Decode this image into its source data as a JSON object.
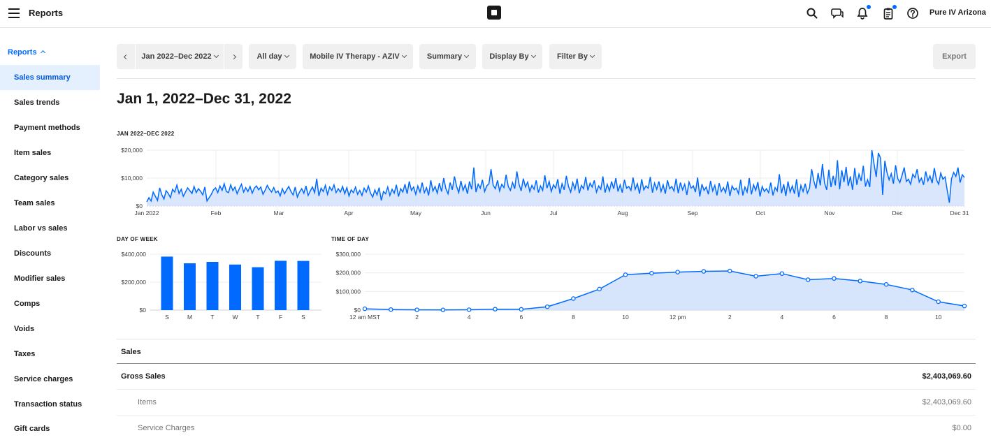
{
  "header": {
    "title": "Reports",
    "account": "Pure IV Arizona"
  },
  "icons": [
    "menu-icon",
    "square-logo-icon",
    "search-icon",
    "messages-icon",
    "notifications-icon",
    "clipboard-icon",
    "help-icon"
  ],
  "colors": {
    "accent": "#006aff",
    "active_bg": "#e5f0ff",
    "chart_fill": "#cfe0fb",
    "bar": "#006aff"
  },
  "sidebar": {
    "header": "Reports",
    "items": [
      {
        "label": "Sales summary",
        "active": true
      },
      {
        "label": "Sales trends"
      },
      {
        "label": "Payment methods"
      },
      {
        "label": "Item sales"
      },
      {
        "label": "Category sales"
      },
      {
        "label": "Team sales"
      },
      {
        "label": "Labor vs sales"
      },
      {
        "label": "Discounts"
      },
      {
        "label": "Modifier sales"
      },
      {
        "label": "Comps"
      },
      {
        "label": "Voids"
      },
      {
        "label": "Taxes"
      },
      {
        "label": "Service charges"
      },
      {
        "label": "Transaction status"
      },
      {
        "label": "Gift cards"
      }
    ]
  },
  "toolbar": {
    "date_range": "Jan 2022–Dec 2022",
    "time": "All day",
    "location": "Mobile IV Therapy - AZIV",
    "view": "Summary",
    "display_by": "Display By",
    "filter_by": "Filter By",
    "export": "Export"
  },
  "page_title": "Jan 1, 2022–Dec 31, 2022",
  "chart_data": [
    {
      "type": "area",
      "title": "JAN 2022–DEC 2022",
      "x_tick_labels": [
        "Jan 2022",
        "Feb",
        "Mar",
        "Apr",
        "May",
        "Jun",
        "Jul",
        "Aug",
        "Sep",
        "Oct",
        "Nov",
        "Dec",
        "Dec 31"
      ],
      "y_tick_labels": [
        "$0",
        "$10,000",
        "$20,000"
      ],
      "ylim": [
        0,
        20000
      ],
      "grid": true,
      "series": [
        {
          "values": [
            1500,
            3000,
            1800,
            5000,
            3500,
            2000,
            6500,
            4000,
            2500,
            5500,
            4500,
            3000,
            6000,
            5000,
            7500,
            4500,
            6000,
            3500,
            5000,
            6500,
            5500,
            4500,
            7000,
            4800,
            6200,
            5300,
            4000,
            6800,
            1800,
            3000,
            4200,
            5800,
            6500,
            4800,
            7200,
            5600,
            8000,
            5200,
            4800,
            7600,
            5500,
            6800,
            4400,
            6200,
            7800,
            5000,
            6600,
            5200,
            7000,
            4600,
            6400,
            7200,
            5800,
            6800,
            4200,
            5600,
            7400,
            6000,
            5000,
            6600,
            4800,
            5400,
            3600,
            6200,
            4400,
            5800,
            7000,
            5200,
            4000,
            6800,
            3200,
            5000,
            6200,
            4600,
            7200,
            3800,
            5400,
            6800,
            4800,
            9800,
            3600,
            6400,
            5200,
            7400,
            4200,
            6800,
            5600,
            7600,
            4800,
            6200,
            5000,
            7000,
            4400,
            6600,
            3600,
            5800,
            4800,
            6800,
            4200,
            5600,
            3800,
            6400,
            5000,
            7200,
            4600,
            3200,
            5800,
            4000,
            6600,
            2000,
            5200,
            4400,
            6800,
            3800,
            6000,
            4600,
            7600,
            3400,
            6200,
            5000,
            7800,
            4400,
            8800,
            5600,
            6800,
            4200,
            7200,
            5000,
            8400,
            4800,
            6600,
            3800,
            9200,
            5400,
            7000,
            4600,
            8200,
            5200,
            10000,
            6200,
            4400,
            8400,
            5800,
            10600,
            7000,
            4800,
            9000,
            5600,
            7600,
            4400,
            8800,
            6000,
            13800,
            5000,
            7800,
            6400,
            9400,
            5200,
            7200,
            8000,
            13200,
            7400,
            6200,
            9200,
            5400,
            7800,
            6600,
            11200,
            7000,
            5600,
            8400,
            6200,
            12400,
            7800,
            5400,
            9800,
            6800,
            8600,
            5200,
            7400,
            6000,
            9200,
            4800,
            7200,
            5600,
            11000,
            6400,
            8800,
            5200,
            7600,
            6400,
            9600,
            4400,
            8000,
            5800,
            10800,
            7000,
            5000,
            8400,
            6000,
            9800,
            4600,
            7400,
            6200,
            10400,
            5600,
            8200,
            6800,
            9200,
            5000,
            7200,
            6000,
            10600,
            4800,
            7800,
            5400,
            8800,
            6200,
            10000,
            5200,
            7600,
            4800,
            9400,
            6400,
            7000,
            5600,
            10200,
            6000,
            8000,
            4400,
            9600,
            5800,
            7200,
            6400,
            10400,
            4800,
            8200,
            6000,
            8800,
            5200,
            7600,
            4400,
            9200,
            6200,
            7000,
            5400,
            9800,
            4600,
            8400,
            5800,
            7800,
            4000,
            8600,
            6400,
            7200,
            5000,
            10200,
            3400,
            7800,
            5600,
            6800,
            4200,
            9000,
            5400,
            7400,
            3800,
            8200,
            5200,
            6600,
            4800,
            8800,
            3600,
            7200,
            5800,
            6400,
            4400,
            9400,
            3800,
            6800,
            5000,
            10000,
            4200,
            7600,
            5600,
            8600,
            3400,
            7000,
            5200,
            6200,
            4800,
            8400,
            3800,
            6600,
            5400,
            11400,
            4600,
            7800,
            3600,
            8800,
            5000,
            7200,
            4400,
            9600,
            3200,
            7400,
            5200,
            8000,
            4600,
            6400,
            13200,
            9000,
            6200,
            11800,
            7400,
            15000,
            8200,
            5800,
            13000,
            6800,
            10800,
            7400,
            16400,
            6000,
            12800,
            8600,
            14000,
            7200,
            10600,
            5800,
            13600,
            7600,
            11400,
            9000,
            14400,
            7000,
            9400,
            6800,
            20000,
            15000,
            10400,
            19000,
            17200,
            4000,
            16200,
            12000,
            9400,
            11600,
            8000,
            14600,
            9800,
            8400,
            11000,
            13800,
            8800,
            9600,
            7800,
            11400,
            10200,
            13200,
            8600,
            10000,
            7600,
            12400,
            9000,
            10800,
            8200,
            13600,
            9400,
            7800,
            11800,
            9600,
            10400,
            5600,
            1200,
            9800,
            12000,
            10600,
            13800,
            8400,
            11200,
            10200
          ]
        }
      ]
    },
    {
      "type": "bar",
      "title": "DAY OF WEEK",
      "categories": [
        "S",
        "M",
        "T",
        "W",
        "T",
        "F",
        "S"
      ],
      "values": [
        383000,
        335000,
        345000,
        326000,
        307000,
        353000,
        352000
      ],
      "y_tick_labels": [
        "$0",
        "$200,000",
        "$400,000"
      ],
      "ylim": [
        0,
        400000
      ]
    },
    {
      "type": "area",
      "title": "TIME OF DAY",
      "x_tick_labels": [
        "12 am MST",
        "2",
        "4",
        "6",
        "8",
        "10",
        "12 pm",
        "2",
        "4",
        "6",
        "8",
        "10"
      ],
      "y_tick_labels": [
        "$0",
        "$100,000",
        "$200,000",
        "$300,000"
      ],
      "ylim": [
        0,
        300000
      ],
      "series": [
        {
          "values": [
            7000,
            3000,
            1500,
            1000,
            2000,
            5000,
            4000,
            18000,
            62000,
            113000,
            190000,
            198000,
            204000,
            208000,
            210000,
            182000,
            196000,
            163000,
            170000,
            156000,
            138000,
            108000,
            45000,
            22000
          ]
        }
      ]
    }
  ],
  "table": {
    "header": "Sales",
    "rows": [
      {
        "label": "Gross Sales",
        "value": "$2,403,069.60",
        "style": "bold"
      },
      {
        "label": "Items",
        "value": "$2,403,069.60",
        "style": "sub"
      },
      {
        "label": "Service Charges",
        "value": "$0.00",
        "style": "sub"
      }
    ]
  }
}
